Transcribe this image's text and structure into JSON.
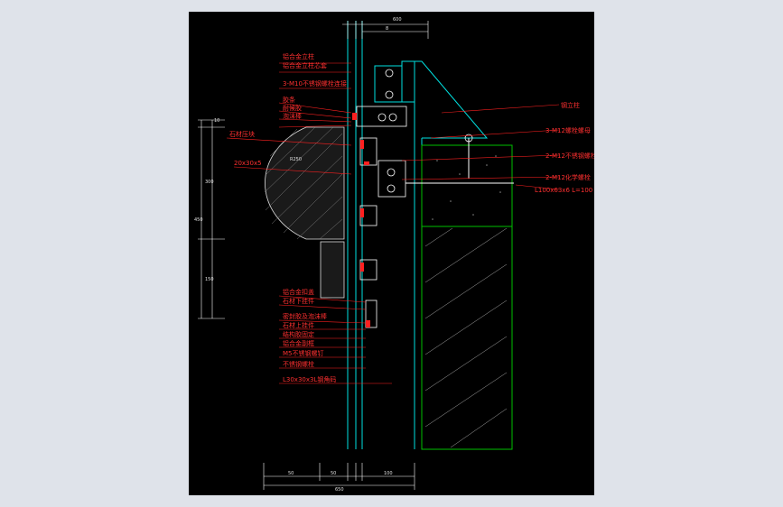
{
  "viewer": {
    "background": "#dfe3ea",
    "sheet_background": "#000000"
  },
  "colors": {
    "callout": "#ff2020",
    "glass": "#00e0e0",
    "dimension": "#ffffff",
    "hatch": "#cccccc",
    "steel": "#00c000",
    "bolt": "#ffffff"
  },
  "labels_left": [
    "铝合金立柱",
    "铝合金立柱芯套",
    "3-M10不锈钢螺栓连接",
    "胶条",
    "耐候胶",
    "泡沫棒",
    "石材压块",
    "20x30x5",
    "铝合金扣盖",
    "石材下挂件",
    "密封胶及泡沫棒",
    "石材上挂件",
    "结构胶固定",
    "铝合金副框",
    "M5不锈钢螺钉",
    "不锈钢螺栓",
    "L30x30x3L钢角码"
  ],
  "labels_right": [
    "钢立柱",
    "3-M12螺栓螺母",
    "2-M12不锈钢螺栓",
    "2-M12化学螺栓",
    "L100x63x6  L=100"
  ],
  "dims_top": [
    "8",
    "600"
  ],
  "dims_bottom": [
    "50",
    "50",
    "100"
  ],
  "dims_bottom_total": "650",
  "dims_left": [
    "10",
    "300",
    "450",
    "150"
  ],
  "radius_label": "R250"
}
